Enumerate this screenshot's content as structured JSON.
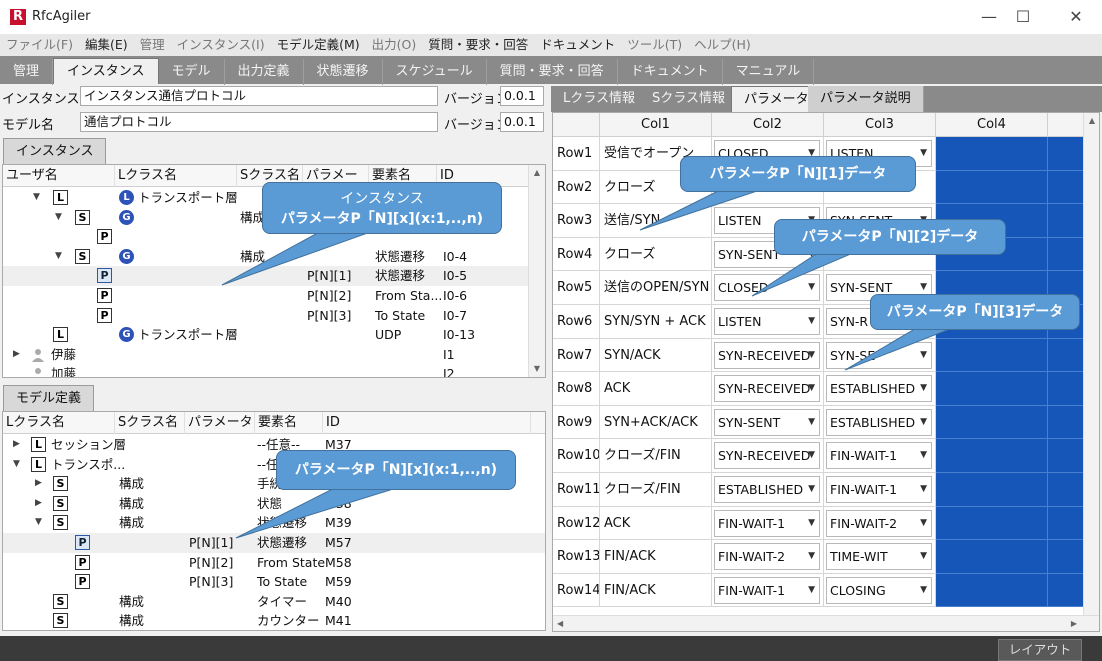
{
  "app": {
    "title": "RfcAgiler",
    "logo": "R"
  },
  "window_controls": {
    "minimize": "—",
    "maximize": "☐",
    "close": "✕"
  },
  "menu": [
    "ファイル(F)",
    "編集(E)",
    "管理",
    "インスタンス(I)",
    "モデル定義(M)",
    "出力(O)",
    "質問・要求・回答",
    "ドキュメント",
    "ツール(T)",
    "ヘルプ(H)"
  ],
  "main_tabs": [
    "管理",
    "インスタンス",
    "モデル",
    "出力定義",
    "状態遷移",
    "スケジュール",
    "質問・要求・回答",
    "ドキュメント",
    "マニュアル"
  ],
  "form": {
    "instance_label": "インスタンス名",
    "instance_value": "インスタンス通信プロトコル",
    "model_label": "モデル名",
    "model_value": "通信プロトコル",
    "version_label": "バージョン",
    "version_value1": "0.0.1",
    "version_value2": "0.0.1"
  },
  "instance_pane": {
    "tab": "インスタンス",
    "columns": [
      "ユーザ名",
      "Lクラス名",
      "Sクラス名",
      "パラメータ",
      "要素名",
      "ID"
    ],
    "rows": [
      {
        "lname": "トランスポート層",
        "sname": "",
        "param": "",
        "elem": "",
        "id": ""
      },
      {
        "lname": "",
        "sname": "構成",
        "param": "",
        "elem": "",
        "id": ""
      },
      {
        "lname": "",
        "sname": "",
        "param": "",
        "elem": "",
        "id": ""
      },
      {
        "lname": "",
        "sname": "構成",
        "param": "",
        "elem": "状態遷移",
        "id": "I0-4"
      },
      {
        "lname": "",
        "sname": "",
        "param": "P[N][1]",
        "elem": "状態遷移",
        "id": "I0-5"
      },
      {
        "lname": "",
        "sname": "",
        "param": "P[N][2]",
        "elem": "From Sta...",
        "id": "I0-6"
      },
      {
        "lname": "",
        "sname": "",
        "param": "P[N][3]",
        "elem": "To State",
        "id": "I0-7"
      },
      {
        "lname": "トランスポート層",
        "sname": "",
        "param": "",
        "elem": "UDP",
        "id": "I0-13"
      },
      {
        "user": "伊藤",
        "id": "I1"
      },
      {
        "user": "加藤",
        "id": "I2"
      }
    ]
  },
  "model_pane": {
    "tab": "モデル定義",
    "columns": [
      "Lクラス名",
      "Sクラス名",
      "パラメータ",
      "要素名",
      "ID"
    ],
    "rows": [
      {
        "lname": "セッション層",
        "sname": "",
        "param": "",
        "elem": "--任意--",
        "id": "M37"
      },
      {
        "lname": "トランスポ...",
        "sname": "",
        "param": "",
        "elem": "--任意--",
        "id": ""
      },
      {
        "sname": "構成",
        "param": "",
        "elem": "手続き",
        "id": ""
      },
      {
        "sname": "構成",
        "param": "",
        "elem": "状態",
        "id": "M38"
      },
      {
        "sname": "構成",
        "param": "",
        "elem": "状態遷移",
        "id": "M39"
      },
      {
        "sname": "",
        "param": "P[N][1]",
        "elem": "状態遷移",
        "id": "M57"
      },
      {
        "sname": "",
        "param": "P[N][2]",
        "elem": "From State",
        "id": "M58"
      },
      {
        "sname": "",
        "param": "P[N][3]",
        "elem": "To State",
        "id": "M59"
      },
      {
        "sname": "構成",
        "param": "",
        "elem": "タイマー",
        "id": "M40"
      },
      {
        "sname": "構成",
        "param": "",
        "elem": "カウンター",
        "id": "M41"
      }
    ]
  },
  "right_tabs": [
    "Lクラス情報",
    "Sクラス情報",
    "パラメータ",
    "パラメータ説明"
  ],
  "grid": {
    "columns": [
      "Col1",
      "Col2",
      "Col3",
      "Col4"
    ],
    "rows": [
      {
        "h": "Row1",
        "c1": "受信でオープン",
        "c2": "CLOSED",
        "c3": "LISTEN"
      },
      {
        "h": "Row2",
        "c1": "クローズ",
        "c2": "",
        "c3": ""
      },
      {
        "h": "Row3",
        "c1": "送信/SYN",
        "c2": "LISTEN",
        "c3": "SYN-SENT"
      },
      {
        "h": "Row4",
        "c1": "クローズ",
        "c2": "SYN-SENT",
        "c3": ""
      },
      {
        "h": "Row5",
        "c1": "送信のOPEN/SYN",
        "c2": "CLOSED",
        "c3": "SYN-SENT"
      },
      {
        "h": "Row6",
        "c1": "SYN/SYN + ACK",
        "c2": "LISTEN",
        "c3": "SYN-R"
      },
      {
        "h": "Row7",
        "c1": "SYN/ACK",
        "c2": "SYN-RECEIVED",
        "c3": "SYN-SE"
      },
      {
        "h": "Row8",
        "c1": "ACK",
        "c2": "SYN-RECEIVED",
        "c3": "ESTABLISHED"
      },
      {
        "h": "Row9",
        "c1": "SYN+ACK/ACK",
        "c2": "SYN-SENT",
        "c3": "ESTABLISHED"
      },
      {
        "h": "Row10",
        "c1": "クローズ/FIN",
        "c2": "SYN-RECEIVED",
        "c3": "FIN-WAIT-1"
      },
      {
        "h": "Row11",
        "c1": "クローズ/FIN",
        "c2": "ESTABLISHED",
        "c3": "FIN-WAIT-1"
      },
      {
        "h": "Row12",
        "c1": "ACK",
        "c2": "FIN-WAIT-1",
        "c3": "FIN-WAIT-2"
      },
      {
        "h": "Row13",
        "c1": "FIN/ACK",
        "c2": "FIN-WAIT-2",
        "c3": "TIME-WIT"
      },
      {
        "h": "Row14",
        "c1": "FIN/ACK",
        "c2": "FIN-WAIT-1",
        "c3": "CLOSING"
      }
    ]
  },
  "callouts": {
    "instance_line1": "インスタンス",
    "instance_line2": "パラメータP「N][x](x:1,..,n)",
    "model": "パラメータP「N][x](x:1,..,n)",
    "p1": "パラメータP「N][1]データ",
    "p2": "パラメータP「N][2]データ",
    "p3": "パラメータP「N][3]データ"
  },
  "status": {
    "layout_button": "レイアウト"
  },
  "colors": {
    "accent_blue": "#1656b8",
    "callout": "#5b9bd5",
    "tab_bar": "#8a8a8a"
  }
}
